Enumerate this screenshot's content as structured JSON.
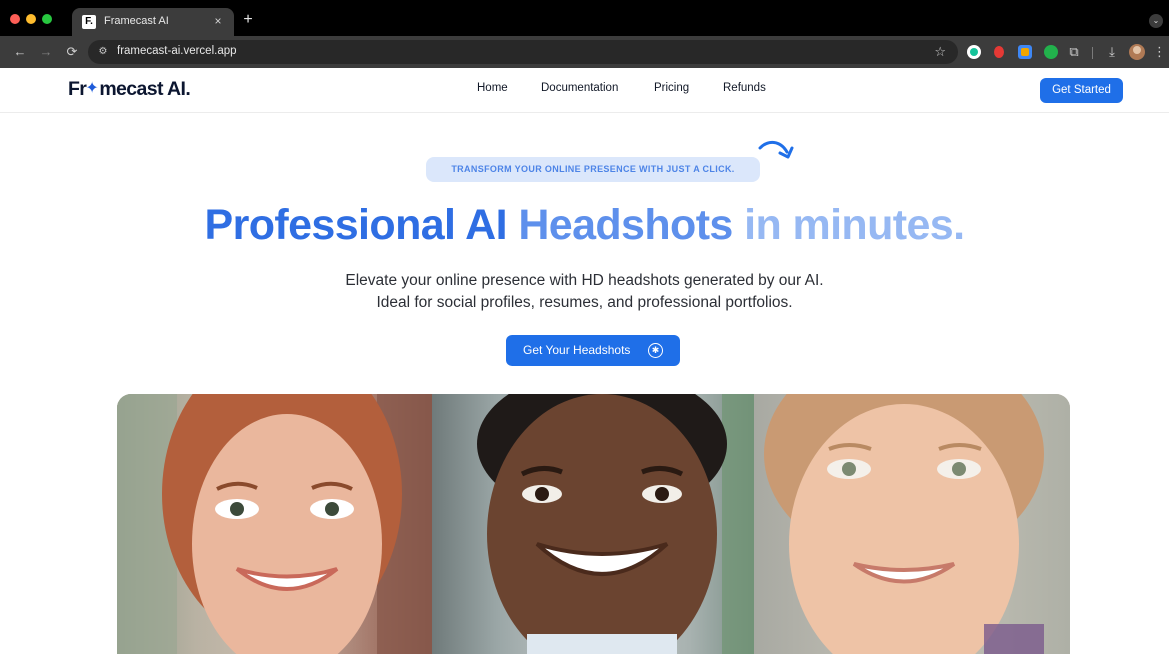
{
  "browser": {
    "tab_title": "Framecast AI",
    "tab_favicon_text": "F.",
    "url": "framecast-ai.vercel.app",
    "close_glyph": "×",
    "new_tab_glyph": "+"
  },
  "site": {
    "logo_text_before": "Fr",
    "logo_text_after": "mecast AI.",
    "nav": [
      {
        "label": "Home"
      },
      {
        "label": "Documentation"
      },
      {
        "label": "Pricing"
      },
      {
        "label": "Refunds"
      }
    ],
    "header_cta": "Get Started",
    "accent_color": "#1f6fe8"
  },
  "hero": {
    "badge": "TRANSFORM YOUR ONLINE PRESENCE WITH JUST A CLICK.",
    "title_parts": [
      "Professional AI ",
      "Headshots ",
      "in minutes."
    ],
    "subtitle_line_1": "Elevate your online presence with HD headshots generated by our AI.",
    "subtitle_line_2": "Ideal for social profiles, resumes, and professional portfolios.",
    "cta": "Get Your Headshots"
  },
  "icons": {
    "site_info": "tune-icon",
    "star": "bookmark-star-icon",
    "cta": "sparkle-circle-icon",
    "arrow": "curved-arrow-icon"
  }
}
